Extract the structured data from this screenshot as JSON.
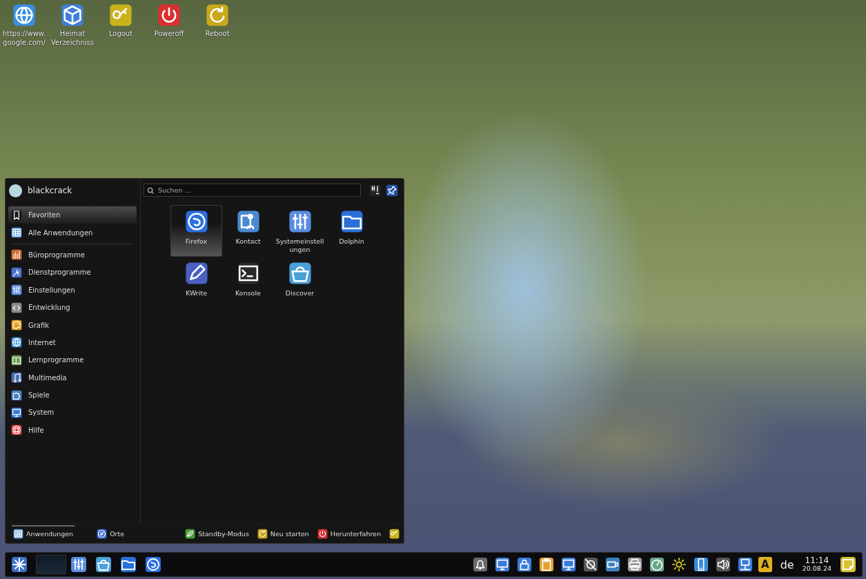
{
  "desktop_icons": [
    {
      "label": "https://www.\ngoogle.com/"
    },
    {
      "label": "Heimat\nVerzeichniss"
    },
    {
      "label": "Logout"
    },
    {
      "label": "Poweroff"
    },
    {
      "label": "Reboot"
    }
  ],
  "menu": {
    "user": {
      "name": "blackcrack"
    },
    "search": {
      "placeholder": "Suchen ..."
    },
    "sidebar": {
      "items": [
        {
          "label": "Favoriten",
          "selected": true
        },
        {
          "label": "Alle Anwendungen",
          "selected": false
        }
      ],
      "categories": [
        {
          "label": "Büroprogramme"
        },
        {
          "label": "Dienstprogramme"
        },
        {
          "label": "Einstellungen"
        },
        {
          "label": "Entwicklung"
        },
        {
          "label": "Grafik"
        },
        {
          "label": "Internet"
        },
        {
          "label": "Lernprogramme"
        },
        {
          "label": "Multimedia"
        },
        {
          "label": "Spiele"
        },
        {
          "label": "System"
        },
        {
          "label": "Hilfe"
        }
      ]
    },
    "apps": [
      {
        "label": "Firefox",
        "selected": true
      },
      {
        "label": "Kontact",
        "selected": false
      },
      {
        "label": "Systemeinstell\nungen",
        "selected": false
      },
      {
        "label": "Dolphin",
        "selected": false
      },
      {
        "label": "KWrite",
        "selected": false
      },
      {
        "label": "Konsole",
        "selected": false
      },
      {
        "label": "Discover",
        "selected": false
      }
    ],
    "bottom_tabs": [
      {
        "label": "Anwendungen",
        "selected": true
      },
      {
        "label": "Orte",
        "selected": false
      }
    ],
    "session_buttons": [
      {
        "label": "Standby-Modus"
      },
      {
        "label": "Neu starten"
      },
      {
        "label": "Herunterfahren"
      }
    ]
  },
  "taskbar": {
    "keyboard_layout": "de",
    "tray_letter": "A",
    "clock": {
      "time": "11:14",
      "date": "20.08.24"
    }
  }
}
